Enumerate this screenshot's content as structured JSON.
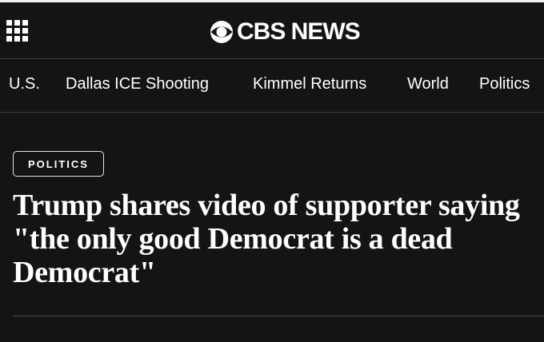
{
  "header": {
    "logo_text": "CBS NEWS",
    "menu_icon": "grid-menu-icon",
    "logo_icon": "cbs-eye-icon"
  },
  "nav": {
    "items": [
      {
        "label": "U.S."
      },
      {
        "label": "Dallas ICE Shooting"
      },
      {
        "label": "Kimmel Returns"
      },
      {
        "label": "World"
      },
      {
        "label": "Politics"
      }
    ]
  },
  "article": {
    "category": "POLITICS",
    "headline": "Trump shares video of supporter saying \"the only good Democrat is a dead Democrat\""
  },
  "colors": {
    "background": "#141414",
    "text": "#ffffff",
    "divider": "#3a3a3a"
  }
}
